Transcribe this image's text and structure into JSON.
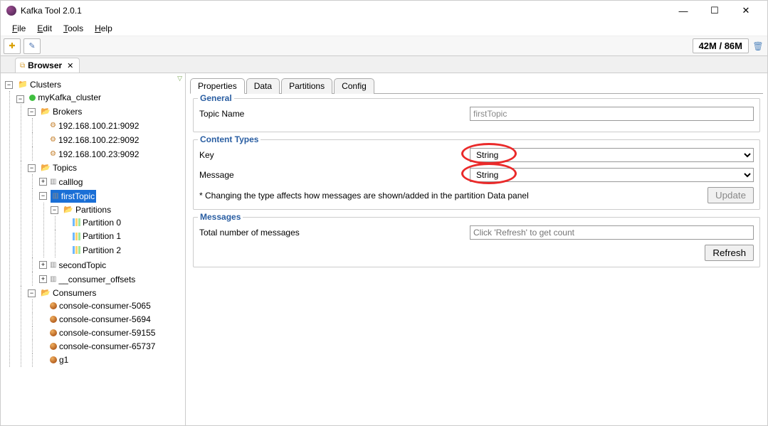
{
  "title": "Kafka Tool  2.0.1",
  "menus": {
    "file": "File",
    "edit": "Edit",
    "tools": "Tools",
    "help": "Help"
  },
  "mem": "42M / 86M",
  "outerTab": {
    "label": "Browser"
  },
  "tree": {
    "clusters": "Clusters",
    "cluster": "myKafka_cluster",
    "brokers": "Brokers",
    "brokerList": [
      "192.168.100.21:9092",
      "192.168.100.22:9092",
      "192.168.100.23:9092"
    ],
    "topics": "Topics",
    "calllog": "calllog",
    "firstTopic": "firstTopic",
    "partitions": "Partitions",
    "partitionList": [
      "Partition 0",
      "Partition 1",
      "Partition 2"
    ],
    "secondTopic": "secondTopic",
    "consumerOffsets": "__consumer_offsets",
    "consumers": "Consumers",
    "consumerList": [
      "console-consumer-5065",
      "console-consumer-5694",
      "console-consumer-59155",
      "console-consumer-65737",
      "g1"
    ]
  },
  "tabs": {
    "properties": "Properties",
    "data": "Data",
    "partitions": "Partitions",
    "config": "Config"
  },
  "general": {
    "legend": "General",
    "topicNameLabel": "Topic Name",
    "topicNameValue": "firstTopic"
  },
  "contentTypes": {
    "legend": "Content Types",
    "keyLabel": "Key",
    "keyValue": "String",
    "messageLabel": "Message",
    "messageValue": "String",
    "note": "* Changing the type affects how messages are shown/added in the partition Data panel",
    "updateBtn": "Update"
  },
  "messages": {
    "legend": "Messages",
    "totalLabel": "Total number of messages",
    "placeholder": "Click 'Refresh' to get count",
    "refreshBtn": "Refresh"
  }
}
